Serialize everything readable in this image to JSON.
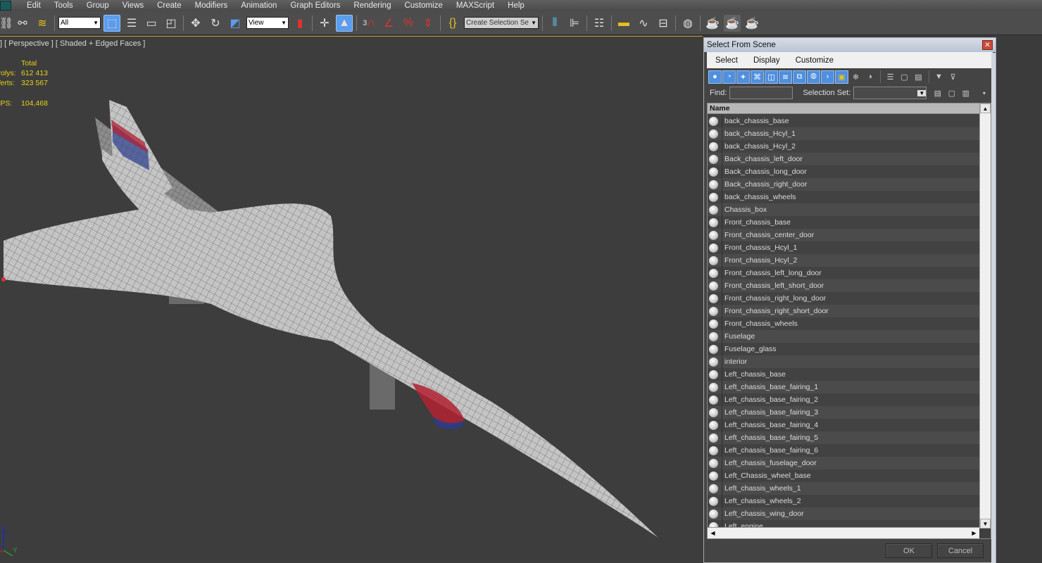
{
  "menubar": {
    "items": [
      "Edit",
      "Tools",
      "Group",
      "Views",
      "Create",
      "Modifiers",
      "Animation",
      "Graph Editors",
      "Rendering",
      "Customize",
      "MAXScript",
      "Help"
    ]
  },
  "toolbar": {
    "selection_filter": "All",
    "reference_coord": "View",
    "named_selection_placeholder": "Create Selection Se",
    "snap_toggle_label": "3"
  },
  "viewport": {
    "label": "] [ Perspective ] [ Shaded + Edged Faces ]",
    "stats": {
      "header": "Total",
      "polys_label": "Polys:",
      "polys_value": "612 413",
      "verts_label": "Verts:",
      "verts_value": "323 567",
      "fps_label": "FPS:",
      "fps_value": "104,468"
    },
    "axis": {
      "z": "Z",
      "y": "Y"
    }
  },
  "dialog": {
    "title": "Select From Scene",
    "close_icon": "close-icon",
    "menu": [
      "Select",
      "Display",
      "Customize"
    ],
    "find_label": "Find:",
    "find_value": "",
    "selection_set_label": "Selection Set:",
    "selection_set_value": "",
    "column_header": "Name",
    "objects": [
      "back_chassis_base",
      "back_chassis_Hcyl_1",
      "back_chassis_Hcyl_2",
      "Back_chassis_left_door",
      "Back_chassis_long_door",
      "Back_chassis_right_door",
      "back_chassis_wheels",
      "Chassis_box",
      "Front_chassis_base",
      "Front_chassis_center_door",
      "Front_chassis_Hcyl_1",
      "Front_chassis_Hcyl_2",
      "Front_chassis_left_long_door",
      "Front_chassis_left_short_door",
      "Front_chassis_right_long_door",
      "Front_chassis_right_short_door",
      "Front_chassis_wheels",
      "Fuselage",
      "Fuselage_glass",
      "interior",
      "Left_chassis_base",
      "Left_chassis_base_fairing_1",
      "Left_chassis_base_fairing_2",
      "Left_chassis_base_fairing_3",
      "Left_chassis_base_fairing_4",
      "Left_chassis_base_fairing_5",
      "Left_chassis_base_fairing_6",
      "Left_chassis_fuselage_door",
      "Left_Chassis_wheel_base",
      "Left_chassis_wheels_1",
      "Left_chassis_wheels_2",
      "Left_chassis_wing_door",
      "Left_engine"
    ],
    "ok_label": "OK",
    "cancel_label": "Cancel"
  }
}
